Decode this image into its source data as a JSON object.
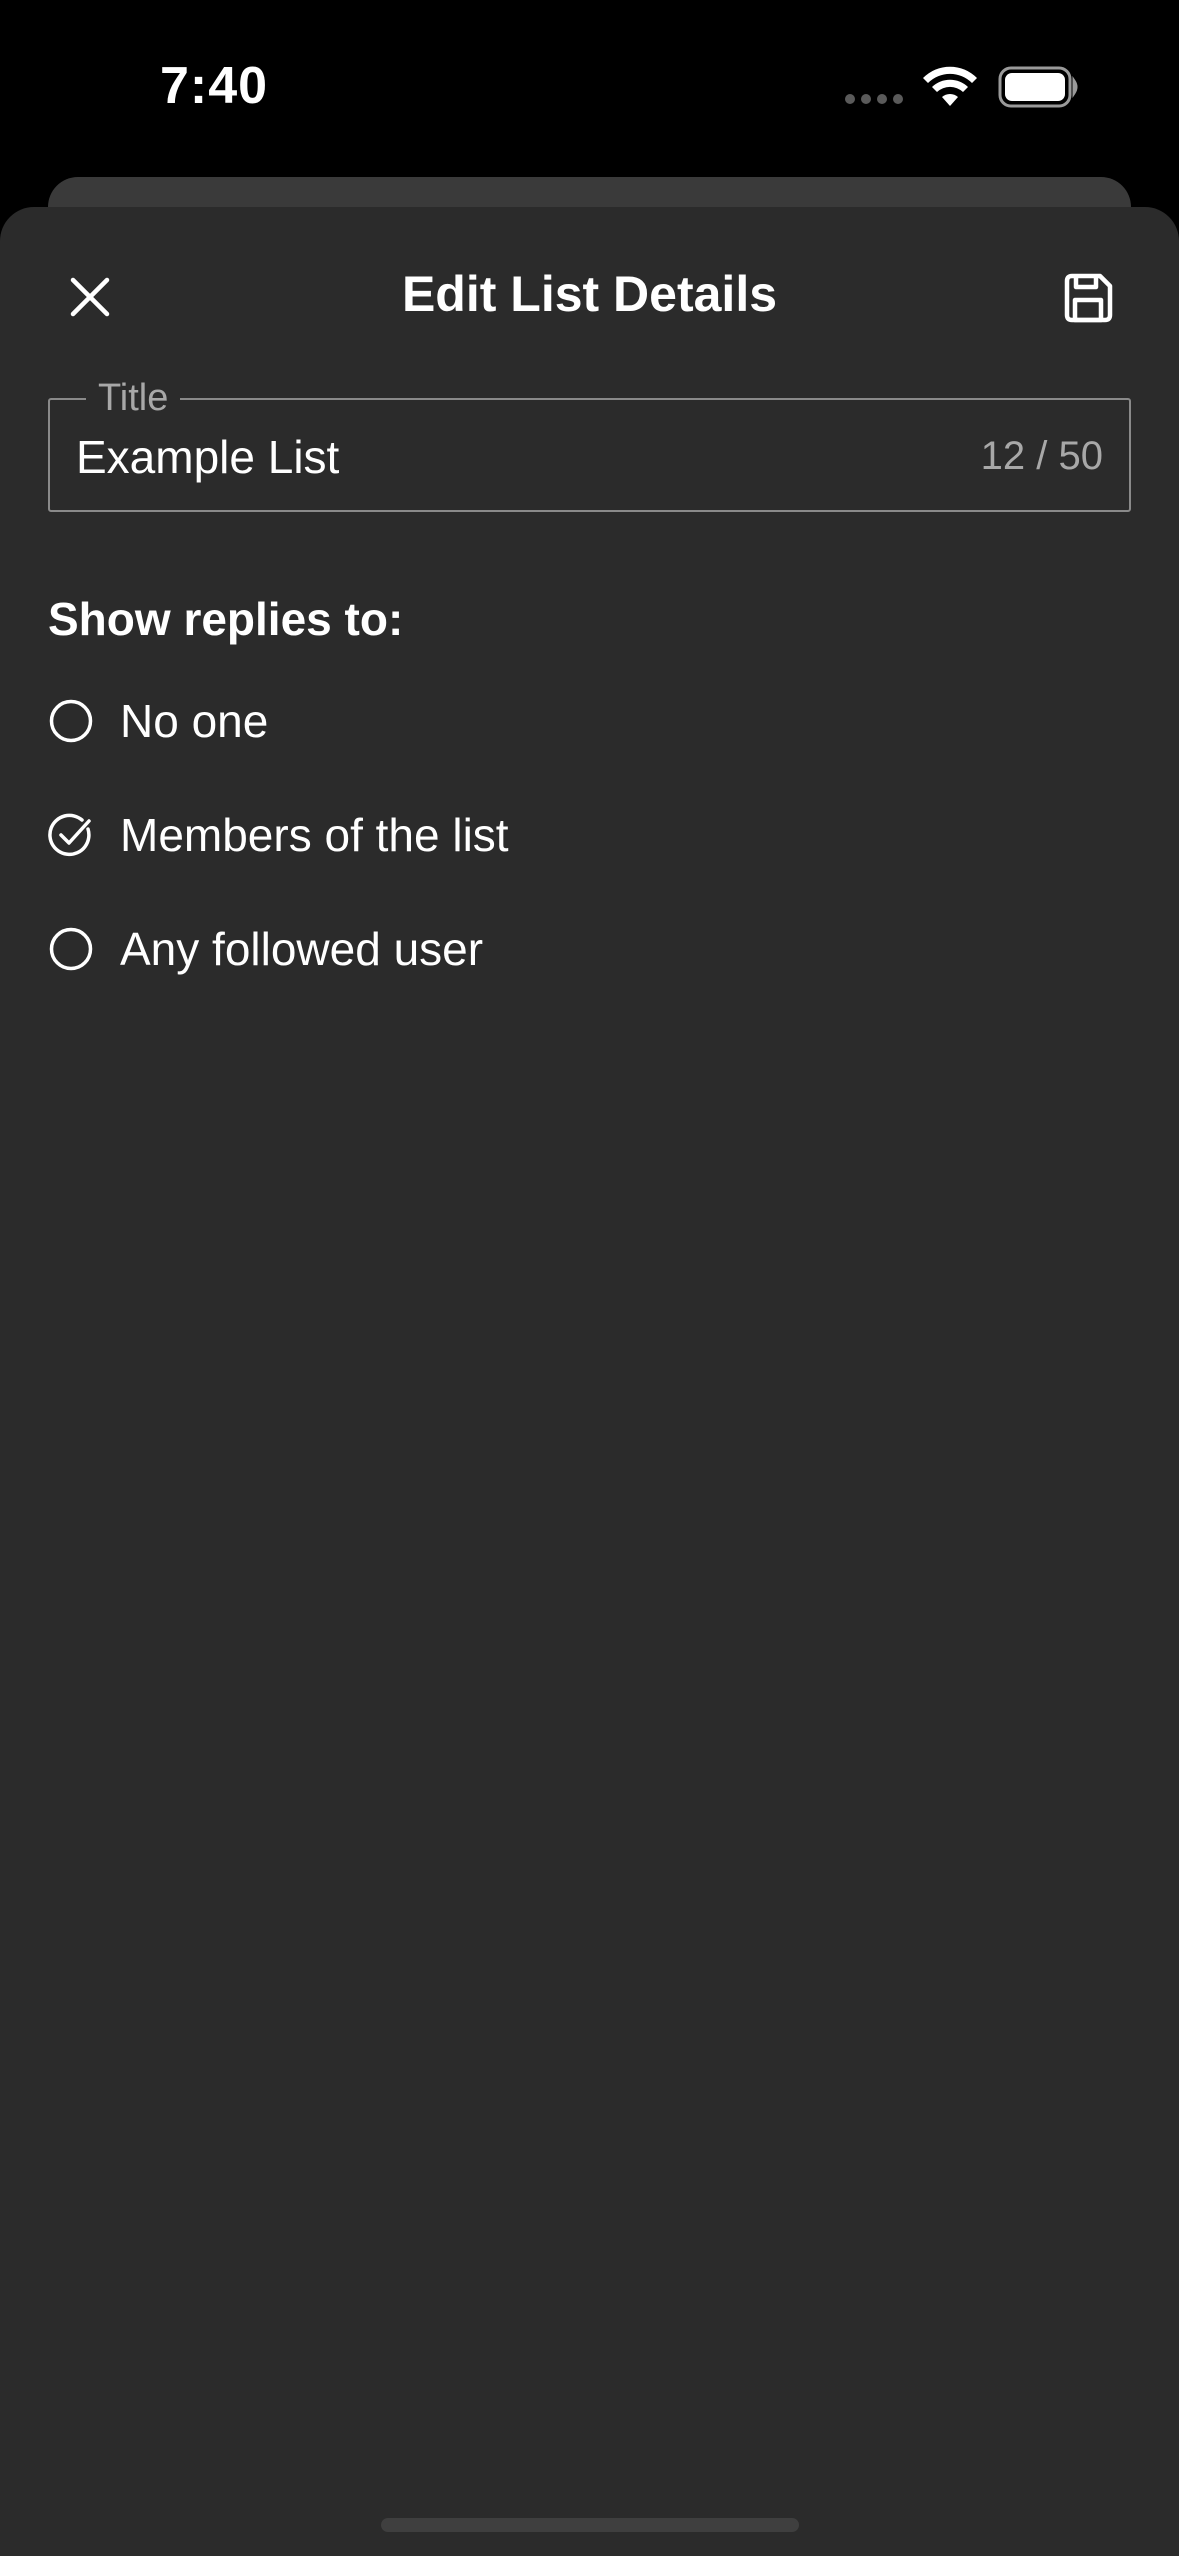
{
  "status_bar": {
    "time": "7:40"
  },
  "sheet": {
    "title": "Edit List Details",
    "close_icon": "close-icon",
    "save_icon": "floppy-disk-icon"
  },
  "title_field": {
    "label": "Title",
    "value": "Example List",
    "counter": "12 / 50"
  },
  "replies": {
    "heading": "Show replies to:",
    "options": [
      {
        "label": "No one",
        "selected": false
      },
      {
        "label": "Members of the list",
        "selected": true
      },
      {
        "label": "Any followed user",
        "selected": false
      }
    ]
  },
  "colors": {
    "sheet_background": "#2b2b2b",
    "text": "#ffffff",
    "secondary_text": "#a8a8a8"
  }
}
